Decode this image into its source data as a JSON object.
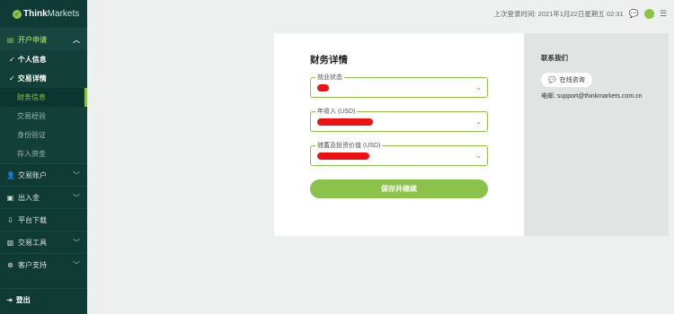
{
  "brand": {
    "think": "Think",
    "markets": "Markets"
  },
  "sidebar": {
    "sections": [
      {
        "label": "开户申请",
        "icon": "document-icon"
      },
      {
        "label": "交易账户",
        "icon": "user-icon"
      },
      {
        "label": "出入金",
        "icon": "wallet-icon"
      },
      {
        "label": "平台下载",
        "icon": "download-icon"
      },
      {
        "label": "交易工具",
        "icon": "toolbox-icon"
      },
      {
        "label": "客户支持",
        "icon": "support-icon"
      }
    ],
    "sub_items": [
      "个人信息",
      "交易详情",
      "财务信息",
      "交易经验",
      "身份验证",
      "存入资金"
    ],
    "logout": "登出"
  },
  "topbar": {
    "last_login": "上次登录时间: 2021年1月22日星期五 02:31"
  },
  "form": {
    "title": "财务详情",
    "fields": [
      {
        "label": "就业状态"
      },
      {
        "label": "年收入 (USD)"
      },
      {
        "label": "储蓄及投资价值 (USD)"
      }
    ],
    "save_label": "保存并继续"
  },
  "contact": {
    "title": "联系我们",
    "chat_label": "在线咨询",
    "email_label": "电邮:",
    "email": "support@thinkmarkets.com.cn"
  },
  "colors": {
    "sidebar_bg": "#0f3b34",
    "accent": "#8bc34a",
    "redaction": "#ee1111"
  }
}
